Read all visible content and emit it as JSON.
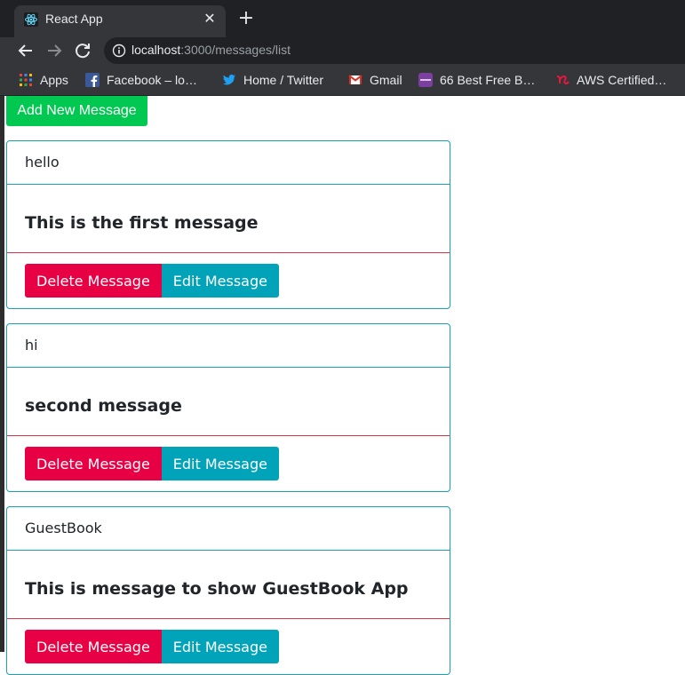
{
  "browser": {
    "tab_title": "React App",
    "url_host": "localhost",
    "url_rest": ":3000/messages/list",
    "bookmarks": [
      {
        "label": "Apps",
        "icon": "apps-grid-icon"
      },
      {
        "label": "Facebook – lo…",
        "icon": "facebook-icon"
      },
      {
        "label": "Home / Twitter",
        "icon": "twitter-icon"
      },
      {
        "label": "Gmail",
        "icon": "gmail-icon"
      },
      {
        "label": "66 Best Free B…",
        "icon": "colorlib-icon"
      },
      {
        "label": "AWS Certified…",
        "icon": "aws-certified-icon"
      }
    ]
  },
  "page": {
    "add_button": "Add New Message",
    "messages": [
      {
        "name": "hello",
        "text": "This is the first message",
        "delete_label": "Delete Message",
        "edit_label": "Edit Message"
      },
      {
        "name": "hi",
        "text": "second message",
        "delete_label": "Delete Message",
        "edit_label": "Edit Message"
      },
      {
        "name": "GuestBook",
        "text": "This is message to show GuestBook App",
        "delete_label": "Delete Message",
        "edit_label": "Edit Message"
      }
    ]
  },
  "colors": {
    "add_button": "#00c851",
    "delete_button": "#e80044",
    "edit_button": "#00a3b7",
    "card_border": "#17a2b8",
    "body_divider": "#dc3545"
  }
}
